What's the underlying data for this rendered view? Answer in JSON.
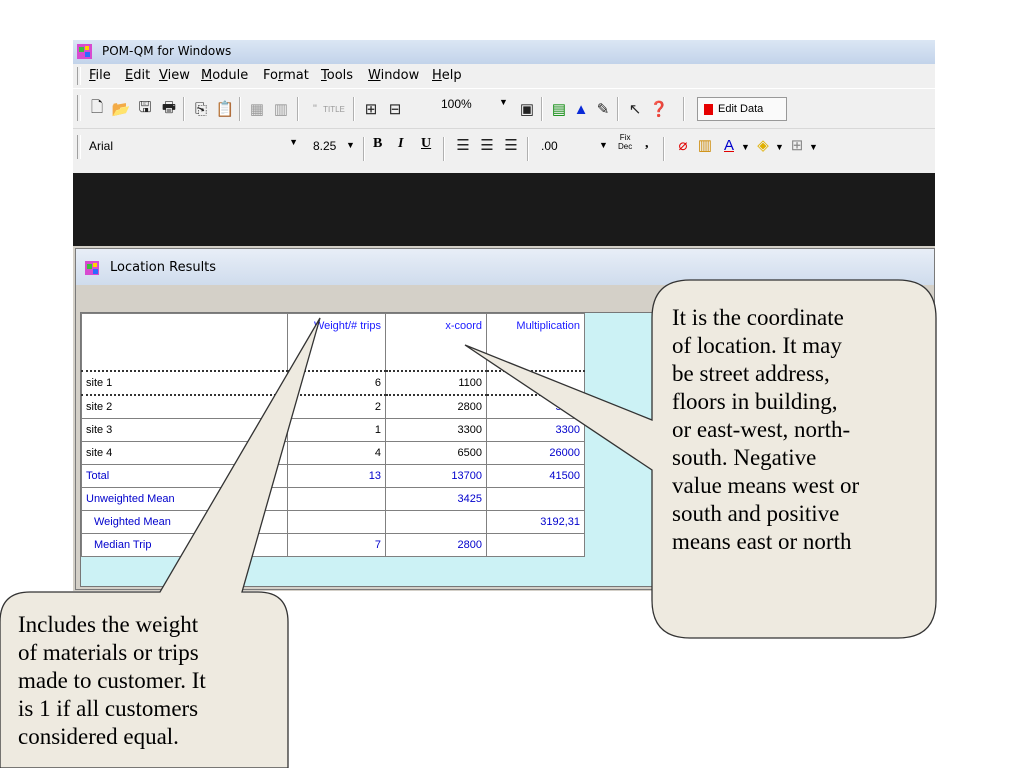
{
  "app": {
    "title": "POM-QM for Windows",
    "menu": [
      "File",
      "Edit",
      "View",
      "Module",
      "Format",
      "Tools",
      "Window",
      "Help"
    ],
    "menu_underline": [
      "F",
      "E",
      "V",
      "M",
      "r",
      "T",
      "W",
      "H"
    ],
    "toolbar": {
      "zoom": "100%",
      "edit_data_label": "Edit Data",
      "title_label": "TITLE"
    },
    "format_bar": {
      "font": "Arial",
      "size": "8.25",
      "bold": "B",
      "italic": "I",
      "underline": "U",
      "decimals": ".00",
      "fix_dec_top": "Fix",
      "fix_dec_bottom": "Dec",
      "comma": ","
    }
  },
  "results": {
    "window_title": "Location Results",
    "columns": [
      "",
      "Weight/# trips",
      "x-coord",
      "Multiplication"
    ],
    "rows": [
      {
        "label": "site 1",
        "weight": "6",
        "x": "1100",
        "mult": ""
      },
      {
        "label": "site 2",
        "weight": "2",
        "x": "2800",
        "mult": "5600"
      },
      {
        "label": "site 3",
        "weight": "1",
        "x": "3300",
        "mult": "3300"
      },
      {
        "label": "site 4",
        "weight": "4",
        "x": "6500",
        "mult": "26000"
      },
      {
        "label": "Total",
        "weight": "13",
        "x": "13700",
        "mult": "41500"
      },
      {
        "label": "Unweighted Mean",
        "weight": "",
        "x": "3425",
        "mult": ""
      },
      {
        "label": "Weighted Mean",
        "weight": "",
        "x": "",
        "mult": "3192,31"
      },
      {
        "label": "Median Trip",
        "weight": "7",
        "x": "2800",
        "mult": ""
      }
    ]
  },
  "callouts": {
    "right": [
      "It is the coordinate",
      "of location. It may",
      "be street address,",
      "floors in building,",
      "or east-west, north-",
      "south. Negative",
      "value means west or",
      "south and positive",
      "means east or north"
    ],
    "left": [
      "Includes the weight",
      "of materials or trips",
      "made to customer. It",
      "is 1 if all customers",
      "considered equal."
    ]
  },
  "colors": {
    "grid_bg": "#ccf2f5",
    "header_text": "#1a1aff",
    "callout_fill": "#eeeae0"
  }
}
